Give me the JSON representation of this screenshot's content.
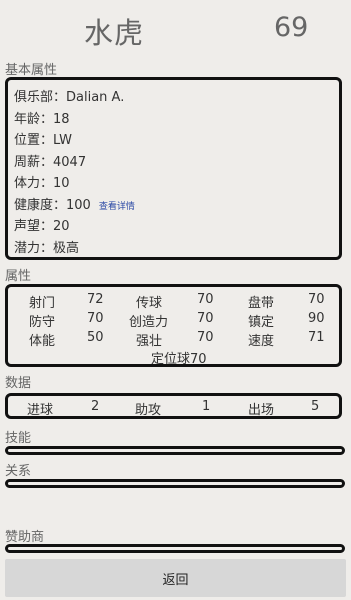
{
  "header": {
    "name": "水虎",
    "overall": "69"
  },
  "sections": {
    "basic": "基本属性",
    "attributes": "属性",
    "stats": "数据",
    "skills": "技能",
    "relations": "关系",
    "sponsors": "赞助商"
  },
  "basic": {
    "club_label": "俱乐部：",
    "club": "Dalian A.",
    "age_label": "年龄：",
    "age": "18",
    "position_label": "位置：",
    "position": "LW",
    "wage_label": "周薪：",
    "wage": "4047",
    "stamina_label": "体力：",
    "stamina": "10",
    "health_label": "健康度：",
    "health": "100",
    "health_link": "查看详情",
    "reputation_label": "声望：",
    "reputation": "20",
    "potential_label": "潜力：",
    "potential": "极高"
  },
  "attributes": {
    "rows": [
      [
        {
          "name": "射门",
          "value": "72"
        },
        {
          "name": "传球",
          "value": "70"
        },
        {
          "name": "盘带",
          "value": "70"
        }
      ],
      [
        {
          "name": "防守",
          "value": "70"
        },
        {
          "name": "创造力",
          "value": "70"
        },
        {
          "name": "镇定",
          "value": "90"
        }
      ],
      [
        {
          "name": "体能",
          "value": "50"
        },
        {
          "name": "强壮",
          "value": "70"
        },
        {
          "name": "速度",
          "value": "71"
        }
      ]
    ],
    "set_piece": "定位球70"
  },
  "stats": [
    {
      "name": "进球",
      "value": "2"
    },
    {
      "name": "助攻",
      "value": "1"
    },
    {
      "name": "出场",
      "value": "5"
    }
  ],
  "buttons": {
    "back": "返回"
  }
}
